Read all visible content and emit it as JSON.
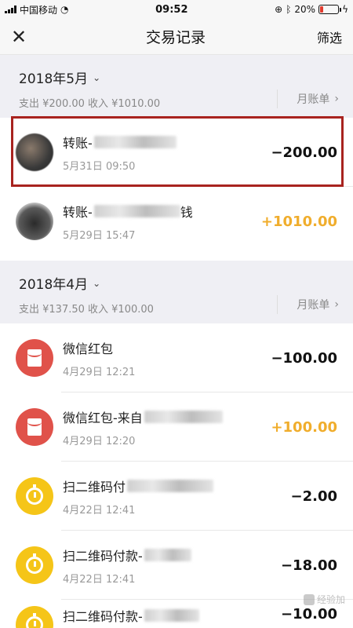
{
  "status_bar": {
    "carrier": "中国移动",
    "time": "09:52",
    "battery_percent": "20%",
    "battery_level": 0.2,
    "icons": [
      "signal-icon",
      "wifi-icon",
      "lock-rotation-icon",
      "bluetooth-icon",
      "battery-icon",
      "charging-icon"
    ]
  },
  "nav": {
    "close_icon": "✕",
    "title": "交易记录",
    "filter_label": "筛选"
  },
  "months": [
    {
      "title": "2018年5月",
      "chevron": "⌄",
      "summary": "支出 ¥200.00 收入 ¥1010.00",
      "bill_label": "月账单",
      "bill_chevron": "›",
      "transactions": [
        {
          "title": "转账-",
          "title_hidden": true,
          "time": "5月31日 09:50",
          "amount": "−200.00",
          "kind": "expense",
          "icon": "contact-avatar"
        },
        {
          "title": "转账-",
          "title_suffix": "钱",
          "title_hidden": true,
          "time": "5月29日 15:47",
          "amount": "+1010.00",
          "kind": "income",
          "icon": "contact-avatar"
        }
      ]
    },
    {
      "title": "2018年4月",
      "chevron": "⌄",
      "summary": "支出 ¥137.50 收入 ¥100.00",
      "bill_label": "月账单",
      "bill_chevron": "›",
      "transactions": [
        {
          "title": "微信红包",
          "time": "4月29日 12:21",
          "amount": "−100.00",
          "kind": "expense",
          "icon": "red-packet-icon"
        },
        {
          "title": "微信红包-来自",
          "title_hidden": true,
          "time": "4月29日 12:20",
          "amount": "+100.00",
          "kind": "income",
          "icon": "red-packet-icon"
        },
        {
          "title": "扫二维码付",
          "title_hidden": true,
          "time": "4月22日 12:41",
          "amount": "−2.00",
          "kind": "expense",
          "icon": "qr-pay-icon"
        },
        {
          "title": "扫二维码付款-",
          "title_hidden": true,
          "time": "4月22日 12:41",
          "amount": "−18.00",
          "kind": "expense",
          "icon": "qr-pay-icon"
        },
        {
          "title": "扫二维码付款-",
          "title_hidden": true,
          "time": "",
          "amount": "−10.00",
          "kind": "expense",
          "icon": "qr-pay-icon"
        }
      ]
    }
  ],
  "colors": {
    "expense": "#111111",
    "income": "#f0ad2c",
    "highlight": "#a8231f",
    "red_packet": "#e0524a",
    "qr_pay": "#f5c518",
    "section_bg": "#efeff4"
  },
  "watermark": "经验加"
}
